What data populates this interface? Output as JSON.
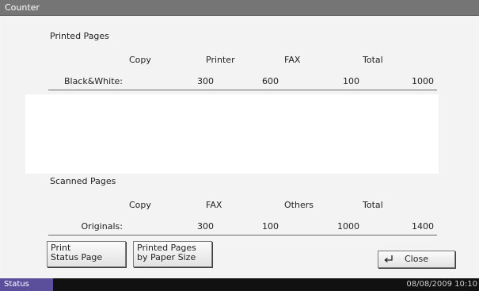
{
  "window": {
    "title": "Counter"
  },
  "printed": {
    "title": "Printed Pages",
    "headers": [
      "Copy",
      "Printer",
      "FAX",
      "Total"
    ],
    "row_label": "Black&White:",
    "values": [
      "300",
      "600",
      "100",
      "1000"
    ]
  },
  "scanned": {
    "title": "Scanned Pages",
    "headers": [
      "Copy",
      "FAX",
      "Others",
      "Total"
    ],
    "row_label": "Originals:",
    "values": [
      "300",
      "100",
      "1000",
      "1400"
    ]
  },
  "buttons": {
    "print_status_line1": "Print",
    "print_status_line2": "Status Page",
    "paper_size_line1": "Printed Pages",
    "paper_size_line2": "by Paper Size",
    "close": "Close"
  },
  "statusbar": {
    "status_label": "Status",
    "datetime": "08/08/2009  10:10"
  },
  "icons": {
    "close": "enter-arrow-icon"
  },
  "colors": {
    "titlebar": "#757575",
    "status_tab": "#5b4f9c",
    "statusbar": "#111111"
  }
}
